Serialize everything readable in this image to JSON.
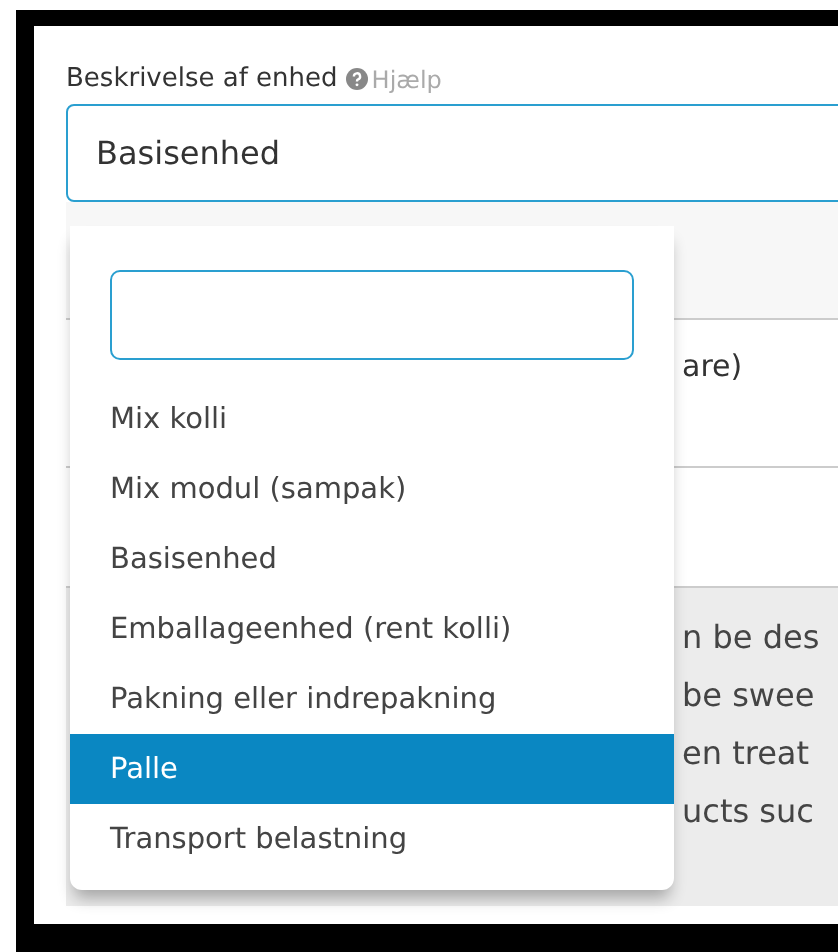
{
  "field": {
    "label": "Beskrivelse af enhed",
    "help": "Hjælp",
    "value": "Basisenhed"
  },
  "dropdown": {
    "options": [
      {
        "label": "Mix kolli",
        "selected": false
      },
      {
        "label": "Mix modul (sampak)",
        "selected": false
      },
      {
        "label": "Basisenhed",
        "selected": false
      },
      {
        "label": "Emballageenhed (rent kolli)",
        "selected": false
      },
      {
        "label": "Pakning eller indrepakning",
        "selected": false
      },
      {
        "label": "Palle",
        "selected": true
      },
      {
        "label": "Transport belastning",
        "selected": false
      }
    ]
  },
  "behind": {
    "row_text": "are)",
    "description_lines": [
      "n be des",
      "be swee",
      "en treat",
      "ucts suc"
    ]
  }
}
